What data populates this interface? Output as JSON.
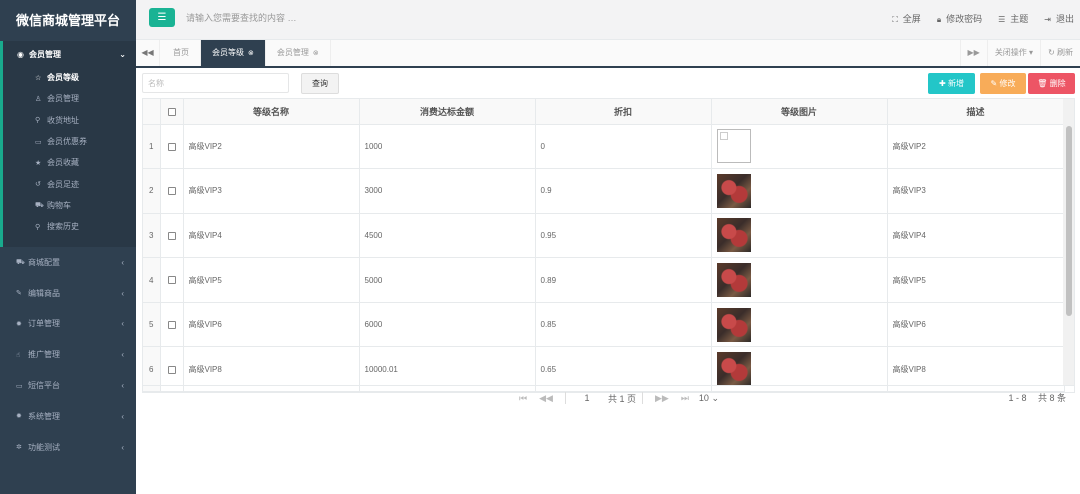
{
  "brand": "微信商城管理平台",
  "sidebar": {
    "open_menu": {
      "label": "会员管理",
      "items": [
        {
          "icon": "star-icon",
          "glyph": "☆",
          "label": "会员等级",
          "active": true
        },
        {
          "icon": "user-icon",
          "glyph": "♙",
          "label": "会员管理"
        },
        {
          "icon": "map-marker-icon",
          "glyph": "⚲",
          "label": "收货地址"
        },
        {
          "icon": "ticket-icon",
          "glyph": "▭",
          "label": "会员优惠券"
        },
        {
          "icon": "star-filled-icon",
          "glyph": "★",
          "label": "会员收藏"
        },
        {
          "icon": "history-icon",
          "glyph": "↺",
          "label": "会员足迹"
        },
        {
          "icon": "cart-icon",
          "glyph": "⛟",
          "label": "购物车"
        },
        {
          "icon": "search-icon",
          "glyph": "⚲",
          "label": "搜索历史"
        }
      ]
    },
    "menus": [
      {
        "icon": "cart-icon",
        "glyph": "⛟",
        "label": "商城配置"
      },
      {
        "icon": "edit-icon",
        "glyph": "✎",
        "label": "编辑商品"
      },
      {
        "icon": "gear-icon",
        "glyph": "✹",
        "label": "订单管理"
      },
      {
        "icon": "hand-icon",
        "glyph": "☝",
        "label": "推广管理"
      },
      {
        "icon": "monitor-icon",
        "glyph": "▭",
        "label": "短信平台"
      },
      {
        "icon": "cog-icon",
        "glyph": "✹",
        "label": "系统管理"
      },
      {
        "icon": "bug-icon",
        "glyph": "✲",
        "label": "功能测试"
      }
    ]
  },
  "topbar": {
    "search_placeholder": "请输入您需要查找的内容 …",
    "actions": [
      {
        "icon": "fullscreen-icon",
        "glyph": "⛶",
        "label": "全屏"
      },
      {
        "icon": "lock-icon",
        "glyph": "🔒︎",
        "label": "修改密码"
      },
      {
        "icon": "list-icon",
        "glyph": "☰",
        "label": "主题"
      },
      {
        "icon": "logout-icon",
        "glyph": "⇥",
        "label": "退出"
      }
    ]
  },
  "tabbar": {
    "tabs": [
      {
        "label": "首页",
        "active": false,
        "closable": false
      },
      {
        "label": "会员等级",
        "active": true,
        "closable": true
      },
      {
        "label": "会员管理",
        "active": false,
        "closable": true
      }
    ],
    "close_ops": "关闭操作",
    "refresh": "刷新"
  },
  "toolbar": {
    "filter_placeholder": "名称",
    "query": "查询",
    "add": "新增",
    "edit": "修改",
    "delete": "删除"
  },
  "table": {
    "columns": [
      "等级名称",
      "消费达标金额",
      "折扣",
      "等级图片",
      "描述"
    ],
    "rows": [
      {
        "n": "1",
        "name": "高级VIP2",
        "amount": "1000",
        "discount": "0",
        "img": "broken",
        "desc": "高级VIP2"
      },
      {
        "n": "2",
        "name": "高级VIP3",
        "amount": "3000",
        "discount": "0.9",
        "img": "photo",
        "desc": "高级VIP3"
      },
      {
        "n": "3",
        "name": "高级VIP4",
        "amount": "4500",
        "discount": "0.95",
        "img": "photo",
        "desc": "高级VIP4"
      },
      {
        "n": "4",
        "name": "高级VIP5",
        "amount": "5000",
        "discount": "0.89",
        "img": "photo",
        "desc": "高级VIP5"
      },
      {
        "n": "5",
        "name": "高级VIP6",
        "amount": "6000",
        "discount": "0.85",
        "img": "photo",
        "desc": "高级VIP6"
      },
      {
        "n": "6",
        "name": "高级VIP8",
        "amount": "10000.01",
        "discount": "0.65",
        "img": "photo",
        "desc": "高级VIP8"
      }
    ]
  },
  "pager": {
    "page": "1",
    "total_pages": "共 1 页",
    "page_size": "10",
    "info": "1 - 8 　共 8 条"
  },
  "colors": {
    "sidebar_bg": "#2f4050",
    "accent": "#1ab394",
    "add": "#23c6c8",
    "edit": "#f8ac59",
    "delete": "#ed5565"
  }
}
